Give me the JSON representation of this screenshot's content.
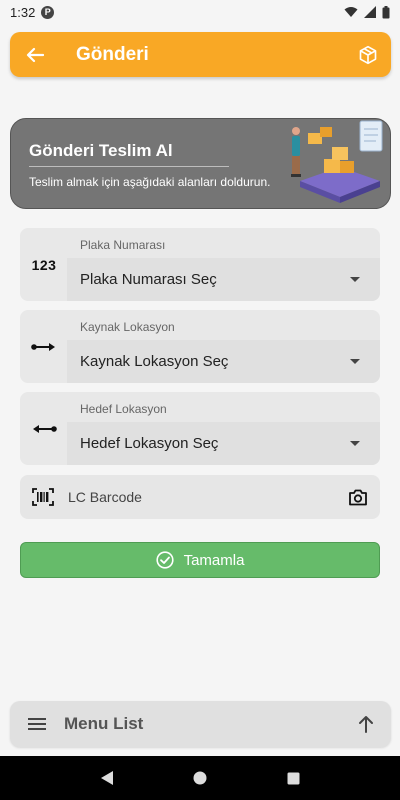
{
  "status_bar": {
    "time": "1:32",
    "notification_letter": "P"
  },
  "header": {
    "title": "Gönderi"
  },
  "banner": {
    "title": "Gönderi Teslim Al",
    "subtitle": "Teslim almak için aşağıdaki alanları doldurun."
  },
  "form": {
    "plate": {
      "label": "Plaka Numarası",
      "icon_text": "123",
      "value": "Plaka Numarası Seç"
    },
    "source": {
      "label": "Kaynak Lokasyon",
      "value": "Kaynak Lokasyon Seç"
    },
    "target": {
      "label": "Hedef Lokasyon",
      "value": "Hedef Lokasyon Seç"
    },
    "barcode": {
      "placeholder": "LC Barcode"
    },
    "complete_label": "Tamamla"
  },
  "menu": {
    "label": "Menu List"
  },
  "colors": {
    "accent": "#f9a825",
    "success": "#66bb6a",
    "banner_bg": "#757575"
  }
}
